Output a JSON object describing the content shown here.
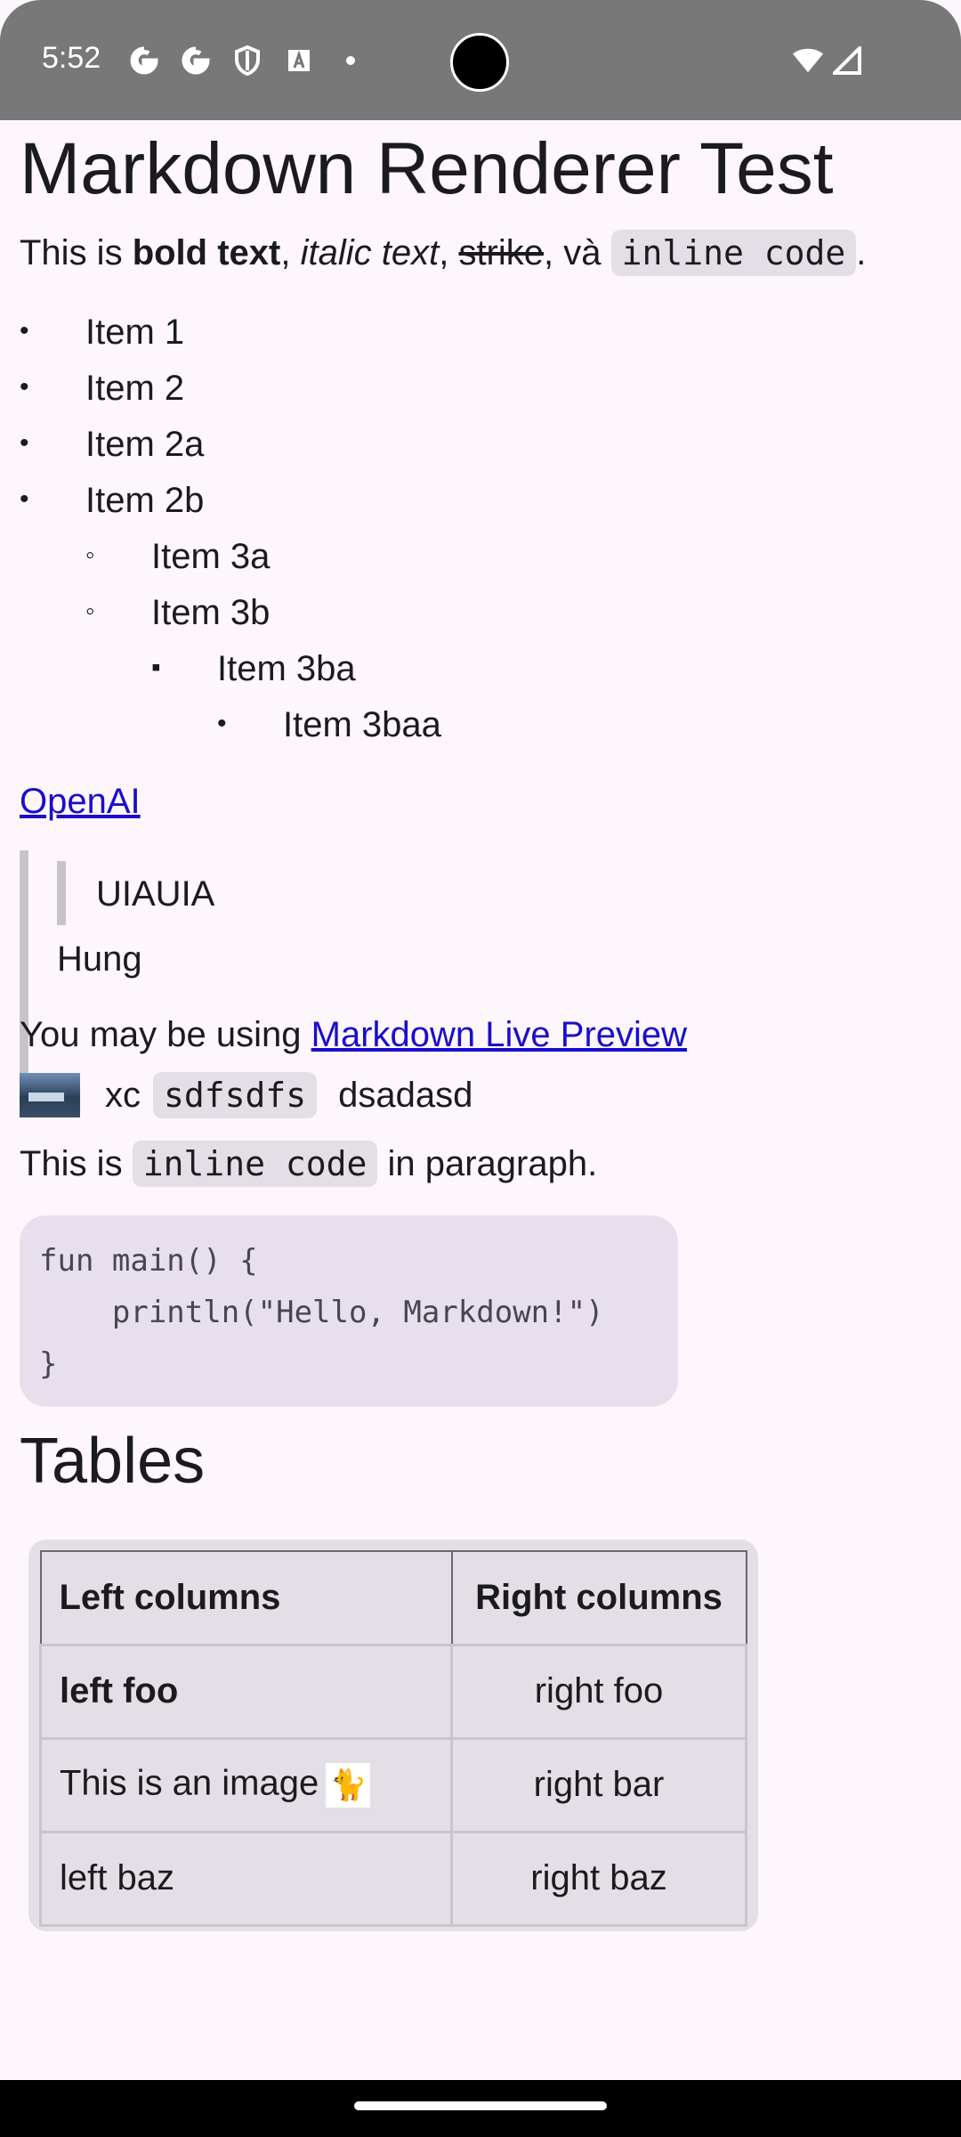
{
  "status_bar": {
    "time": "5:52",
    "left_icons": [
      "google-icon",
      "google-icon",
      "shield-icon",
      "accessibility-icon",
      "dot-icon"
    ],
    "right_icons": [
      "wifi-icon",
      "signal-icon"
    ]
  },
  "doc": {
    "h1": "Markdown Renderer Test",
    "para1": {
      "prefix": "This is ",
      "bold": "bold text",
      "sep1": ", ",
      "italic": "italic text",
      "sep2": ", ",
      "strike": "strike",
      "sep3": ", và ",
      "code": "inline code",
      "suffix": "."
    },
    "list": [
      {
        "label": "Item 1",
        "level": 0,
        "bullet": "•"
      },
      {
        "label": "Item 2",
        "level": 0,
        "bullet": "•"
      },
      {
        "label": "Item 2a",
        "level": 0,
        "bullet": "•"
      },
      {
        "label": "Item 2b",
        "level": 0,
        "bullet": "•"
      },
      {
        "label": "Item 3a",
        "level": 1,
        "bullet": "◦"
      },
      {
        "label": "Item 3b",
        "level": 1,
        "bullet": "◦"
      },
      {
        "label": "Item 3ba",
        "level": 2,
        "bullet": "▪"
      },
      {
        "label": "Item 3baa",
        "level": 3,
        "bullet": "•"
      }
    ],
    "link_openai": "OpenAI",
    "blockquote_inner": "UIAUIA",
    "blockquote_outer": "Hung",
    "para2": {
      "prefix": "You may be using ",
      "link": "Markdown Live Preview"
    },
    "image_row": {
      "text1": "xc",
      "code": "sdfsdfs",
      "text2": "dsadasd"
    },
    "para3": {
      "prefix": "This is ",
      "code": "inline code",
      "suffix": " in paragraph."
    },
    "code_block": "fun main() {\n    println(\"Hello, Markdown!\")\n}",
    "h2": "Tables",
    "table": {
      "headers": [
        "Left columns",
        "Right columns"
      ],
      "rows": [
        {
          "left": "left foo",
          "right": "right foo"
        },
        {
          "left": "This is an image",
          "right": "right bar"
        },
        {
          "left": "left baz",
          "right": "right baz"
        }
      ]
    }
  }
}
